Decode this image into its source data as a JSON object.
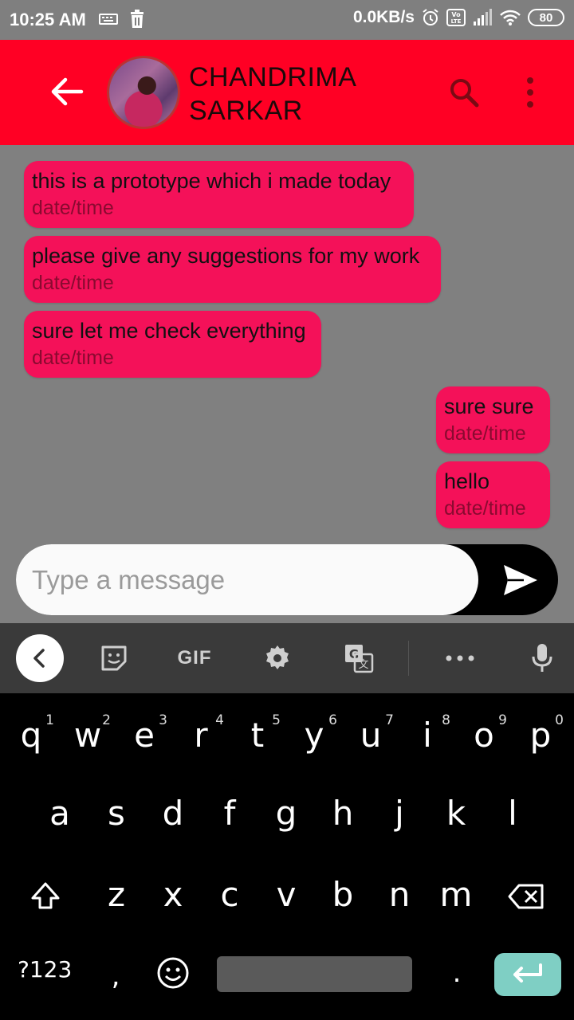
{
  "status_bar": {
    "time": "10:25 AM",
    "network_speed": "0.0KB/s",
    "battery": "80",
    "icons": [
      "keyboard-icon",
      "trash-icon",
      "alarm-icon",
      "volte-icon",
      "signal-icon",
      "wifi-icon",
      "battery-icon"
    ]
  },
  "header": {
    "contact_name": "CHANDRIMA SARKAR",
    "icons": [
      "back-arrow-icon",
      "search-icon",
      "more-vert-icon"
    ],
    "colors": {
      "background": "#ff0024"
    }
  },
  "messages": [
    {
      "text": "this is a prototype which i made today",
      "meta": "date/time",
      "side": "left"
    },
    {
      "text": "please give any suggestions for my work",
      "meta": "date/time",
      "side": "left"
    },
    {
      "text": "sure let me check everything",
      "meta": "date/time",
      "side": "left"
    },
    {
      "text": "sure sure",
      "meta": "date/time",
      "side": "right"
    },
    {
      "text": "hello",
      "meta": "date/time",
      "side": "right"
    }
  ],
  "composer": {
    "placeholder": "Type a message",
    "value": ""
  },
  "keyboard": {
    "toolbar": {
      "gif_label": "GIF",
      "icons": [
        "chevron-left-icon",
        "sticker-icon",
        "gif-icon",
        "settings-icon",
        "translate-icon",
        "more-horiz-icon",
        "mic-icon"
      ]
    },
    "row1": [
      "q",
      "w",
      "e",
      "r",
      "t",
      "y",
      "u",
      "i",
      "o",
      "p"
    ],
    "row1_hints": [
      "1",
      "2",
      "3",
      "4",
      "5",
      "6",
      "7",
      "8",
      "9",
      "0"
    ],
    "row2": [
      "a",
      "s",
      "d",
      "f",
      "g",
      "h",
      "j",
      "k",
      "l"
    ],
    "row3": [
      "z",
      "x",
      "c",
      "v",
      "b",
      "n",
      "m"
    ],
    "symbols_label": "?123",
    "comma": ",",
    "period": ".",
    "colors": {
      "enter": "#7fcfc4",
      "bubble": "#f41159"
    }
  }
}
